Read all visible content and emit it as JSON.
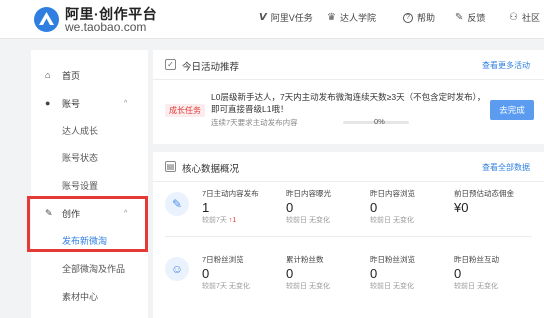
{
  "header": {
    "logo_title": "阿里·创作平台",
    "logo_sub": "we.taobao.com",
    "nav": [
      {
        "icon": "V",
        "label": "阿里V任务"
      },
      {
        "icon": "♛",
        "label": "达人学院"
      },
      {
        "icon": "?",
        "label": "帮助"
      },
      {
        "icon": "✎",
        "label": "反馈"
      },
      {
        "icon": "⚇",
        "label": "社区"
      }
    ]
  },
  "sidebar": {
    "home": "首页",
    "account": "账号",
    "account_items": [
      "达人成长",
      "账号状态",
      "账号设置"
    ],
    "create": "创作",
    "create_items": [
      "发布新微淘",
      "全部微淘及作品",
      "素材中心"
    ]
  },
  "activity": {
    "title": "今日活动推荐",
    "more": "查看更多活动",
    "task_tag": "成长任务",
    "task_desc": "L0层级新手达人，7天内主动发布微淘连续天数≥3天（不包含定时发布），即可直接晋级L1哦！",
    "progress_label": "连续7天要求主动发布内容",
    "progress_value": 0,
    "progress_pct": "0%",
    "complete_btn": "去完成"
  },
  "core": {
    "title": "核心数据概况",
    "more": "查看全部数据",
    "row1": [
      {
        "label": "7日主动内容发布",
        "value": "1",
        "compare": "较前7天",
        "delta": "↑1"
      },
      {
        "label": "昨日内容曝光",
        "value": "0",
        "compare": "较前日 无变化",
        "delta": ""
      },
      {
        "label": "昨日内容浏览",
        "value": "0",
        "compare": "较前日 无变化",
        "delta": ""
      },
      {
        "label": "前日预估动态佣金",
        "value": "¥0",
        "compare": "",
        "delta": ""
      }
    ],
    "row2": [
      {
        "label": "7日粉丝浏览",
        "value": "0",
        "compare": "较前7天 无变化",
        "delta": ""
      },
      {
        "label": "累计粉丝数",
        "value": "0",
        "compare": "较前日 无变化",
        "delta": ""
      },
      {
        "label": "昨日粉丝浏览",
        "value": "0",
        "compare": "较前日 无变化",
        "delta": ""
      },
      {
        "label": "昨日粉丝互动",
        "value": "0",
        "compare": "较前日 无变化",
        "delta": ""
      }
    ]
  },
  "colors": {
    "accent": "#2f7fe0",
    "highlight": "#e53935",
    "button": "#5b9cf0"
  }
}
